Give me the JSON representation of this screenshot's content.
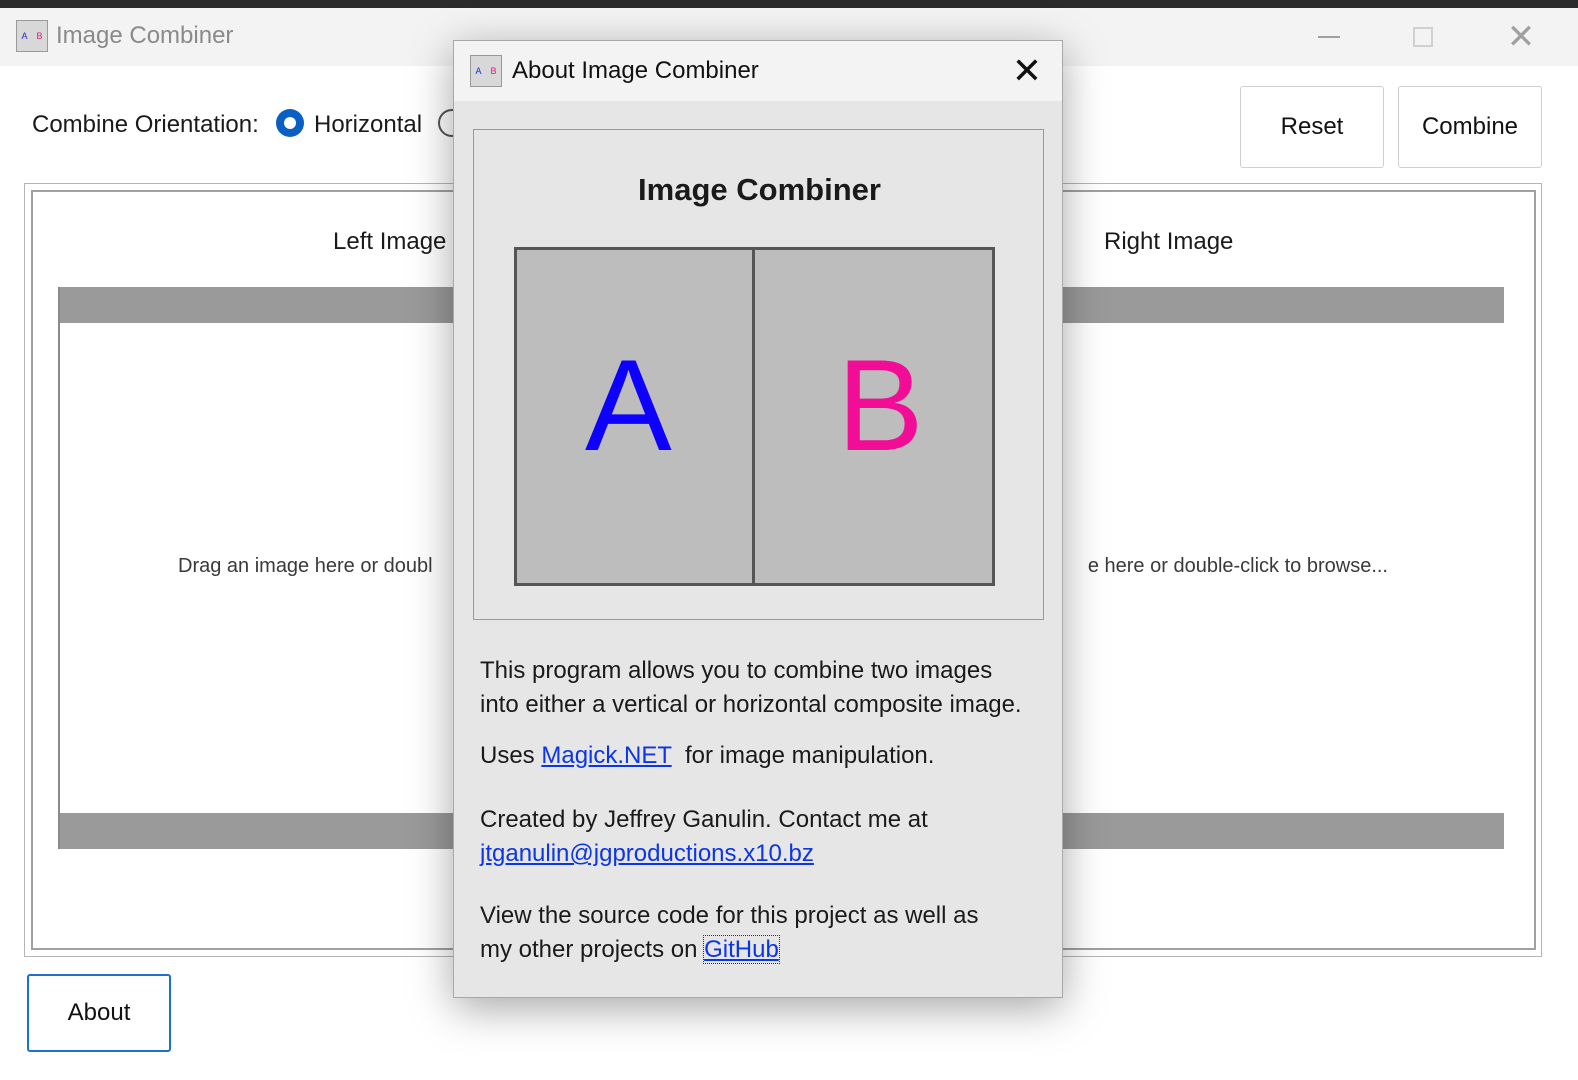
{
  "main_window": {
    "title": "Image Combiner",
    "orientation_label": "Combine Orientation:",
    "orientation_selected": "Horizontal",
    "reset_label": "Reset",
    "combine_label": "Combine",
    "about_label": "About",
    "left_heading": "Left Image",
    "right_heading": "Right Image",
    "left_hint": "Drag an image here or doubl",
    "right_hint": "e here or double-click to browse..."
  },
  "dialog": {
    "title": "About Image Combiner",
    "logo_title": "Image Combiner",
    "logo_letter_a": "A",
    "logo_letter_b": "B",
    "p1_line1": "This program allows you to combine two images",
    "p1_line2": "into either a vertical or horizontal composite image.",
    "p2_prefix": "Uses ",
    "p2_link": "Magick.NET",
    "p2_suffix": "  for image manipulation.",
    "p3_line1": "Created by Jeffrey Ganulin. Contact me at",
    "p3_link": "jtganulin@jgproductions.x10.bz",
    "p4_line1": "View the source code for this project as well as",
    "p4_prefix": "my other projects on ",
    "p4_link": "GitHub"
  },
  "colors": {
    "accent": "#0a5fc4",
    "letter_a": "#0d00ff",
    "letter_b": "#f20d97",
    "link": "#0b35e6"
  }
}
